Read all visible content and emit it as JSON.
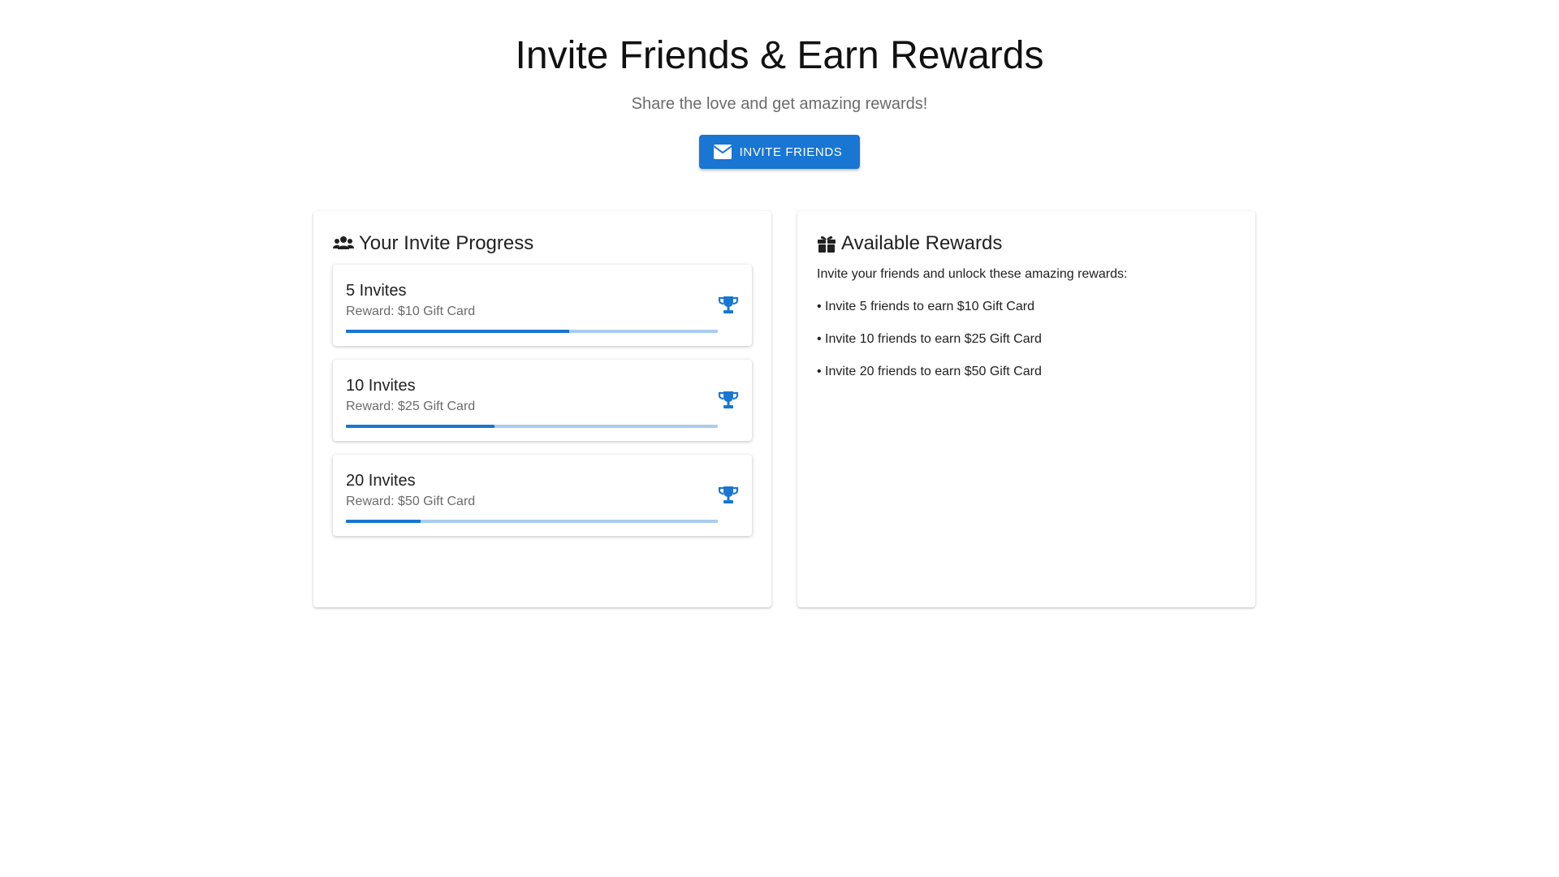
{
  "hero": {
    "title": "Invite Friends & Earn Rewards",
    "subtitle": "Share the love and get amazing rewards!",
    "invite_button_label": "INVITE FRIENDS",
    "invite_button_icon": "envelope-icon"
  },
  "colors": {
    "primary": "#1976d2",
    "progress_track": "#a9cdf0",
    "text": "#212121",
    "muted_text": "#6b6b6b"
  },
  "progress_panel": {
    "title": "Your Invite Progress",
    "icon": "users-icon",
    "tiers": [
      {
        "name": "5 Invites",
        "reward": "Reward: $10 Gift Card",
        "progress_percent": 60,
        "icon": "trophy-icon"
      },
      {
        "name": "10 Invites",
        "reward": "Reward: $25 Gift Card",
        "progress_percent": 40,
        "icon": "trophy-icon"
      },
      {
        "name": "20 Invites",
        "reward": "Reward: $50 Gift Card",
        "progress_percent": 20,
        "icon": "trophy-icon"
      }
    ]
  },
  "rewards_panel": {
    "title": "Available Rewards",
    "icon": "gift-icon",
    "intro": "Invite your friends and unlock these amazing rewards:",
    "items": [
      "• Invite 5 friends to earn $10 Gift Card",
      "• Invite 10 friends to earn $25 Gift Card",
      "• Invite 20 friends to earn $50 Gift Card"
    ]
  }
}
